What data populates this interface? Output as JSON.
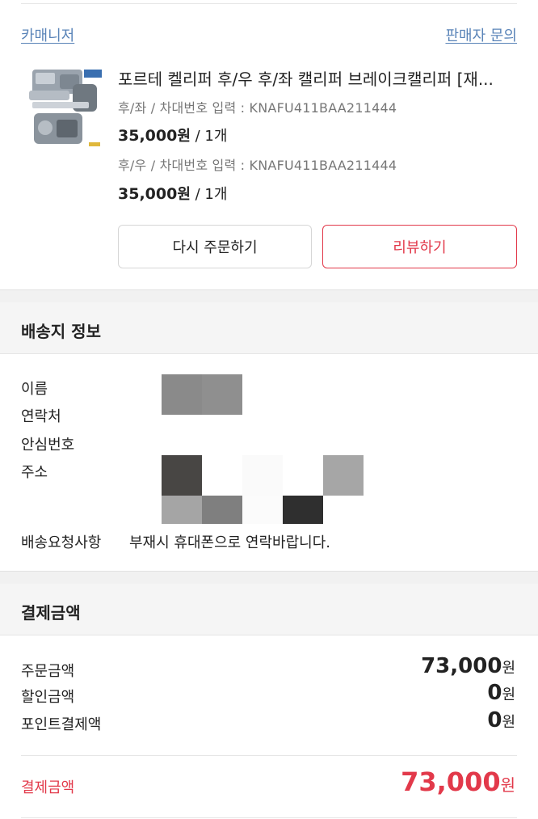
{
  "order": {
    "seller_name": "카매니저",
    "seller_inquiry": "판매자 문의",
    "product_title": "포르테 켈리퍼 후/우 후/좌 캘리퍼 브레이크캘리퍼 [재...",
    "options": [
      {
        "text": "후/좌 / 차대번호 입력 : KNAFU411BAA211444",
        "price": "35,000",
        "won": "원",
        "qty": " / 1개"
      },
      {
        "text": "후/우 / 차대번호 입력 : KNAFU411BAA211444",
        "price": "35,000",
        "won": "원",
        "qty": " / 1개"
      }
    ],
    "reorder_label": "다시 주문하기",
    "review_label": "리뷰하기"
  },
  "shipping": {
    "title": "배송지 정보",
    "labels": {
      "name": "이름",
      "contact": "연락처",
      "safe_number": "안심번호",
      "address": "주소",
      "request": "배송요청사항"
    },
    "request_value": "부재시 휴대폰으로 연락바랍니다."
  },
  "payment": {
    "title": "결제금액",
    "rows": [
      {
        "label": "주문금액",
        "value": "73,000",
        "unit": "원"
      },
      {
        "label": "할인금액",
        "value": "0",
        "unit": "원"
      },
      {
        "label": "포인트결제액",
        "value": "0",
        "unit": "원"
      }
    ],
    "total_label": "결제금액",
    "total_value": "73,000",
    "total_unit": "원"
  },
  "colors": {
    "accent": "#e2394a",
    "link": "#5a84b8"
  }
}
